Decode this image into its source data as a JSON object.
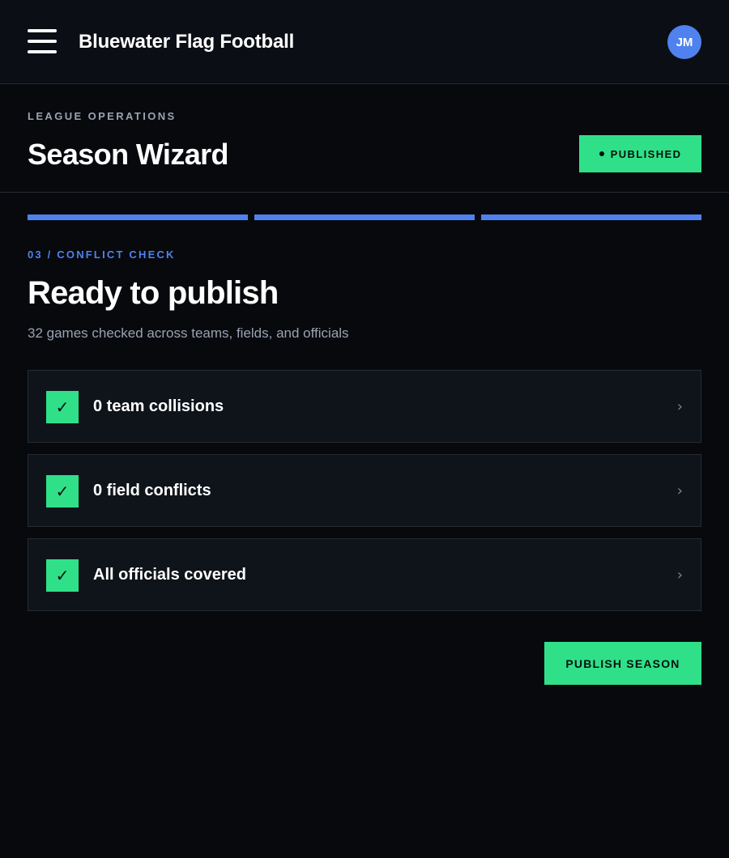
{
  "app": {
    "title": "Bluewater Flag Football",
    "user_initials": "JM",
    "menu_icon": "hamburger-menu-icon"
  },
  "header": {
    "eyebrow": "LEAGUE OPERATIONS",
    "title": "Season Wizard",
    "status": "PUBLISHED"
  },
  "progress": {
    "total_steps": 3,
    "completed_steps": 3
  },
  "step": {
    "label": "03 / CONFLICT CHECK",
    "title": "Ready to publish",
    "subtitle": "32 games checked across teams, fields, and officials"
  },
  "checks": [
    {
      "label": "0 team collisions",
      "status": "pass"
    },
    {
      "label": "0 field conflicts",
      "status": "pass"
    },
    {
      "label": "All officials covered",
      "status": "pass"
    }
  ],
  "icons": {
    "check": "✓",
    "chevron": "›"
  },
  "actions": {
    "publish_label": "PUBLISH SEASON"
  },
  "colors": {
    "accent_green": "#2fe089",
    "accent_blue": "#4f82ee",
    "background": "#07090d"
  }
}
